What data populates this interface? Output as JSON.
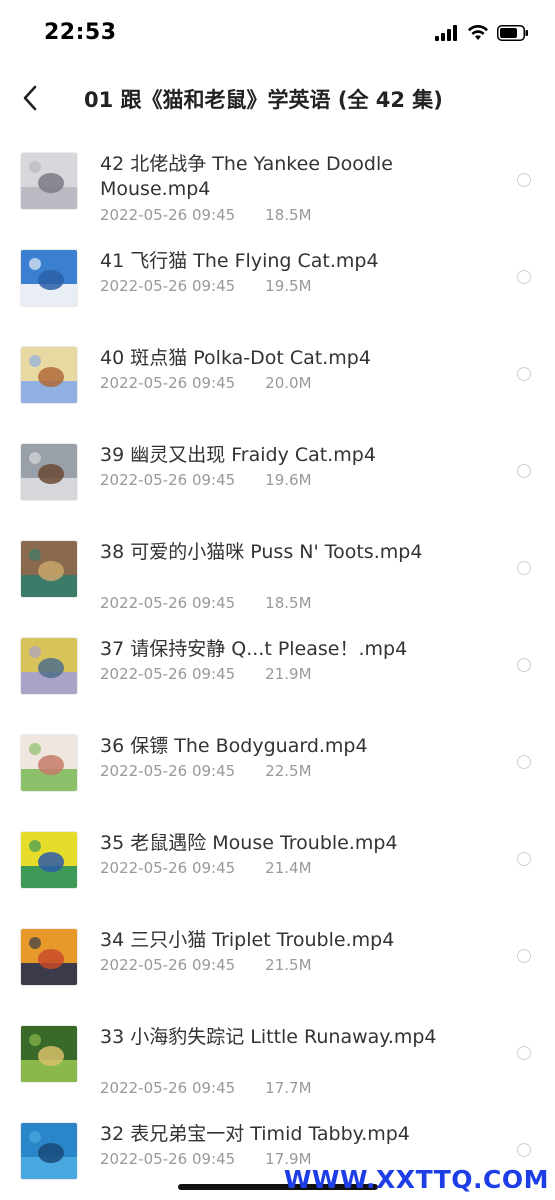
{
  "status_bar": {
    "time": "22:53",
    "icons": [
      "signal-icon",
      "wifi-icon",
      "battery-icon"
    ]
  },
  "header": {
    "back_icon": "chevron-left-icon",
    "title": "01 跟《猫和老鼠》学英语 (全 42 集)"
  },
  "files": [
    {
      "name": "42 北佬战争 The Yankee Doodle Mouse.mp4",
      "date": "2022-05-26 09:45",
      "size": "18.5M",
      "lines": 2,
      "thumb": [
        "#d8d8dc",
        "#bbb9c2",
        "#7c7a84"
      ]
    },
    {
      "name": "41 飞行猫 The Flying Cat.mp4",
      "date": "2022-05-26 09:45",
      "size": "19.5M",
      "lines": 1,
      "thumb": [
        "#3b7fd0",
        "#e9eef5",
        "#2a5fa8"
      ]
    },
    {
      "name": "40 斑点猫 Polka-Dot Cat.mp4",
      "date": "2022-05-26 09:45",
      "size": "20.0M",
      "lines": 1,
      "thumb": [
        "#e8d9a3",
        "#8fb0e0",
        "#b06a3a"
      ]
    },
    {
      "name": "39 幽灵又出现 Fraidy Cat.mp4",
      "date": "2022-05-26 09:45",
      "size": "19.6M",
      "lines": 1,
      "thumb": [
        "#9aa0a8",
        "#d5d7db",
        "#6b4a35"
      ]
    },
    {
      "name": "38 可爱的小猫咪 Puss N' Toots.mp4",
      "date": "2022-05-26 09:45",
      "size": "18.5M",
      "lines": 2,
      "thumb": [
        "#8a6a4e",
        "#3c7a6a",
        "#c9a46a"
      ]
    },
    {
      "name": "37 请保持安静 Q...t Please！.mp4",
      "date": "2022-05-26 09:45",
      "size": "21.9M",
      "lines": 1,
      "thumb": [
        "#d8c25a",
        "#a9a3c8",
        "#4f6f8a"
      ]
    },
    {
      "name": "36 保镖 The Bodyguard.mp4",
      "date": "2022-05-26 09:45",
      "size": "22.5M",
      "lines": 1,
      "thumb": [
        "#efe6df",
        "#8cbf6a",
        "#c77a6a"
      ]
    },
    {
      "name": "35 老鼠遇险 Mouse Trouble.mp4",
      "date": "2022-05-26 09:45",
      "size": "21.4M",
      "lines": 1,
      "thumb": [
        "#e6dd2a",
        "#3f9a5a",
        "#2b5aa8"
      ]
    },
    {
      "name": "34 三只小猫 Triplet Trouble.mp4",
      "date": "2022-05-26 09:45",
      "size": "21.5M",
      "lines": 1,
      "thumb": [
        "#e79a2a",
        "#3a3a4a",
        "#c84a2a"
      ]
    },
    {
      "name": "33 小海豹失踪记 Little Runaway.mp4",
      "date": "2022-05-26 09:45",
      "size": "17.7M",
      "lines": 2,
      "thumb": [
        "#3a6a2a",
        "#8ab84a",
        "#d8c06a"
      ]
    },
    {
      "name": "32 表兄弟宝一对 Timid Tabby.mp4",
      "date": "2022-05-26 09:45",
      "size": "17.9M",
      "lines": 1,
      "thumb": [
        "#2a86c8",
        "#4aa8e0",
        "#1a4a7a"
      ]
    }
  ],
  "watermark": "WWW.XXTTQ.COM"
}
